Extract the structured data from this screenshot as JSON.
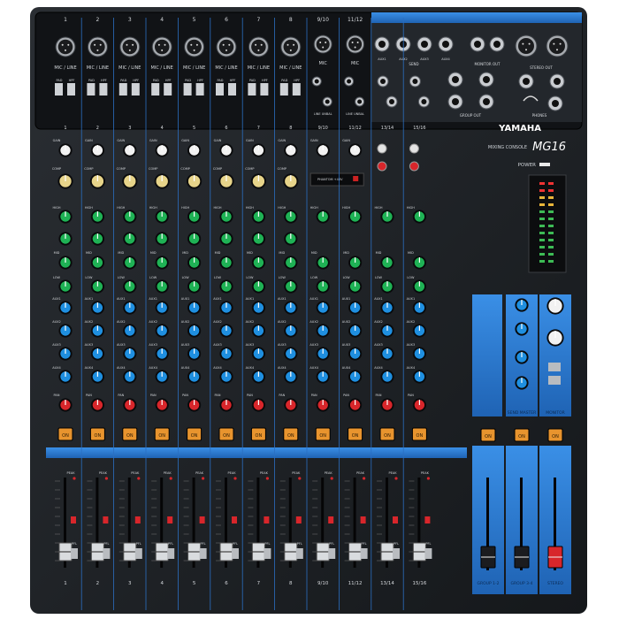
{
  "brand": "YAMAHA",
  "model": "MG16",
  "model_sub": "MIXING CONSOLE",
  "channels": [
    {
      "top": "1",
      "bottom": "1",
      "label": "MIC / LINE",
      "type": "mono"
    },
    {
      "top": "2",
      "bottom": "2",
      "label": "MIC / LINE",
      "type": "mono"
    },
    {
      "top": "3",
      "bottom": "3",
      "label": "MIC / LINE",
      "type": "mono"
    },
    {
      "top": "4",
      "bottom": "4",
      "label": "MIC / LINE",
      "type": "mono"
    },
    {
      "top": "5",
      "bottom": "5",
      "label": "MIC / LINE",
      "type": "mono"
    },
    {
      "top": "6",
      "bottom": "6",
      "label": "MIC / LINE",
      "type": "mono"
    },
    {
      "top": "7",
      "bottom": "7",
      "label": "MIC / LINE",
      "type": "mono"
    },
    {
      "top": "8",
      "bottom": "8",
      "label": "MIC / LINE",
      "type": "mono"
    },
    {
      "top": "9/10",
      "bottom": "9/10",
      "label": "MIC",
      "type": "stereo-mic"
    },
    {
      "top": "11/12",
      "bottom": "11/12",
      "label": "MIC",
      "type": "stereo-mic"
    },
    {
      "top": "",
      "bottom": "13/14",
      "label": "",
      "type": "stereo"
    },
    {
      "top": "",
      "bottom": "15/16",
      "label": "",
      "type": "stereo"
    }
  ],
  "strip_labels": {
    "gain": "GAIN",
    "comp": "COMP",
    "high": "HIGH",
    "mid": "MID",
    "low": "LOW",
    "aux1": "AUX1",
    "aux2": "AUX2",
    "aux3": "AUX3",
    "aux4": "AUX4",
    "pan": "PAN",
    "on": "ON",
    "peak": "PEAK",
    "pfl": "PFL",
    "pad": "PAD",
    "hpf": "HPF"
  },
  "io_labels": {
    "send": "SEND",
    "aux": [
      "AUX1",
      "AUX2",
      "AUX3",
      "AUX4"
    ],
    "monitor_out": "MONITOR OUT",
    "stereo_out": "STEREO OUT",
    "phones": "PHONES",
    "group_out": "GROUP OUT",
    "line_unbal": "LINE UNBAL",
    "phantom": "PHANTOM +48V",
    "power": "POWER"
  },
  "master": {
    "faders": [
      "GROUP 1-2",
      "GROUP 3-4",
      "STEREO"
    ],
    "send_master": "SEND MASTER",
    "monitor": "MONITOR"
  },
  "colors": {
    "chassis": "#1b1e22",
    "blue_accent": "#2f7fd6",
    "knob_green": "#1fb255",
    "knob_blue": "#1f8fe0",
    "knob_red": "#d8262b",
    "knob_yellow": "#e7d48a",
    "on_button": "#e8942e"
  }
}
